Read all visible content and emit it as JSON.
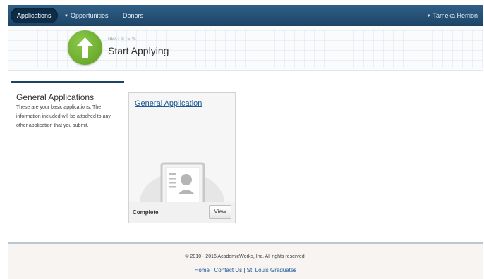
{
  "nav": {
    "applications": "Applications",
    "opportunities": "Opportunities",
    "donors": "Donors",
    "user": "Tameka Herrion",
    "caret": "▼"
  },
  "banner": {
    "eyebrow": "NEXT STEPS",
    "title": "Start Applying",
    "icon": "up-arrow-icon",
    "icon_color": "#6fb033"
  },
  "section": {
    "title": "General Applications",
    "description": "These are your basic applications. The information included will be attached to any other application that you submit."
  },
  "card": {
    "link": "General Application",
    "status": "Complete",
    "button": "View",
    "icon": "profile-document-icon"
  },
  "footer": {
    "copyright": "© 2010 - 2016 AcademicWorks, Inc. All rights reserved.",
    "links": [
      "Home",
      "Contact Us",
      "St. Louis Graduates"
    ],
    "separator": "|"
  },
  "colors": {
    "nav_bg": "#1d4466",
    "link": "#1d5a96",
    "accent_green": "#6fb033"
  }
}
